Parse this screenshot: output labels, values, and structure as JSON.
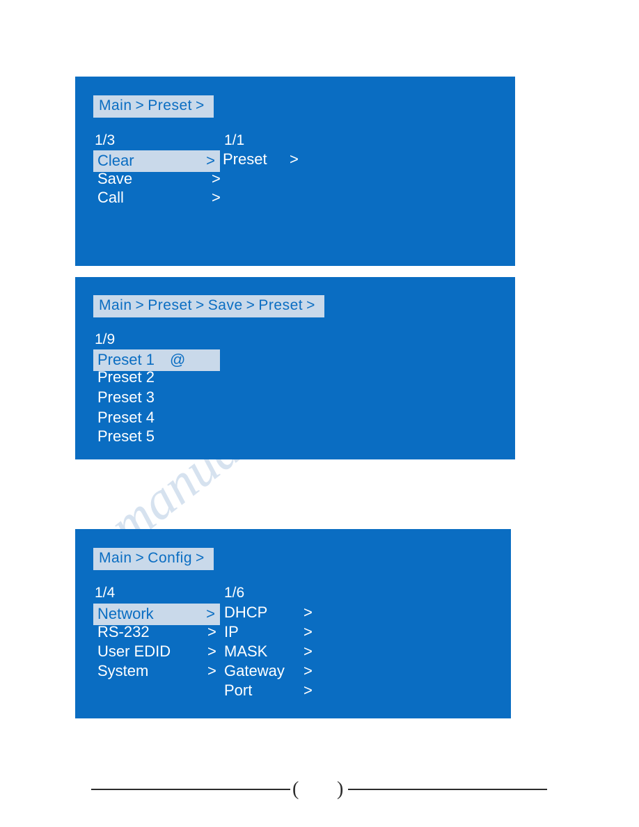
{
  "watermark": {
    "text": "manualshive.com"
  },
  "panels": [
    {
      "id": "preset-menu-panel",
      "breadcrumb": [
        "Main",
        ">",
        "Preset",
        ">"
      ],
      "left_column": {
        "page": "1/3",
        "items": [
          {
            "label": "Clear",
            "arrow": ">",
            "selected": true
          },
          {
            "label": "Save",
            "arrow": ">",
            "selected": false
          },
          {
            "label": "Call",
            "arrow": ">",
            "selected": false
          }
        ]
      },
      "right_column": {
        "page": "1/1",
        "items": [
          {
            "label": "Preset",
            "arrow": ">",
            "selected": false
          }
        ]
      }
    },
    {
      "id": "preset-save-panel",
      "breadcrumb": [
        "Main",
        ">",
        "Preset",
        ">",
        "Save",
        ">",
        "Preset",
        ">"
      ],
      "left_column": {
        "page": "1/9",
        "items": [
          {
            "label": "Preset 1",
            "marker": "@",
            "selected": true
          },
          {
            "label": "Preset 2",
            "marker": "",
            "selected": false
          },
          {
            "label": "Preset 3",
            "marker": "",
            "selected": false
          },
          {
            "label": "Preset 4",
            "marker": "",
            "selected": false
          },
          {
            "label": "Preset 5",
            "marker": "",
            "selected": false
          }
        ]
      }
    },
    {
      "id": "config-menu-panel",
      "breadcrumb": [
        "Main",
        ">",
        "Config",
        ">"
      ],
      "left_column": {
        "page": "1/4",
        "items": [
          {
            "label": "Network",
            "arrow": ">",
            "selected": true
          },
          {
            "label": "RS-232",
            "arrow": ">",
            "selected": false
          },
          {
            "label": "User EDID",
            "arrow": ">",
            "selected": false
          },
          {
            "label": "System",
            "arrow": ">",
            "selected": false
          }
        ]
      },
      "right_column": {
        "page": "1/6",
        "items": [
          {
            "label": "DHCP",
            "arrow": ">",
            "selected": false
          },
          {
            "label": "IP",
            "arrow": ">",
            "selected": false
          },
          {
            "label": "MASK",
            "arrow": ">",
            "selected": false
          },
          {
            "label": "Gateway",
            "arrow": ">",
            "selected": false
          },
          {
            "label": "Port",
            "arrow": ">",
            "selected": false
          }
        ]
      }
    }
  ],
  "footer": {
    "open_paren": "(",
    "close_paren": ")"
  },
  "colors": {
    "lcd_background": "#0a6dc2",
    "highlight_background": "#c9d9ea",
    "highlight_text": "#0a6dc2",
    "text": "#ffffff",
    "watermark": "#c7d7ea"
  }
}
